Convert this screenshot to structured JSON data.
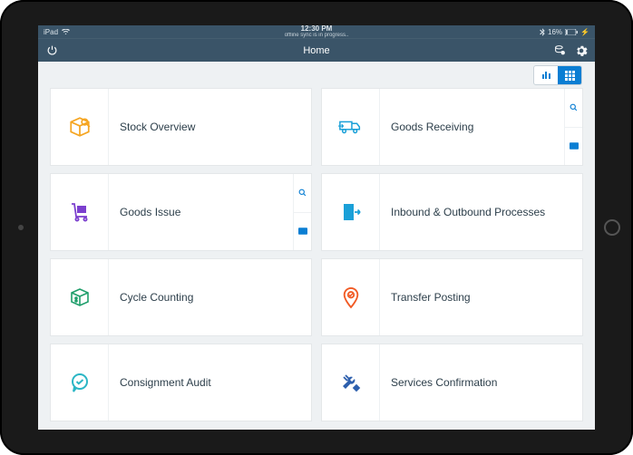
{
  "device": "iPad",
  "statusbar": {
    "time": "12:30 PM",
    "sync_text": "offline sync is in progress..",
    "bluetooth": true,
    "battery_text": "16%"
  },
  "navbar": {
    "title": "Home"
  },
  "view_toggle": {
    "chart_active": false,
    "grid_active": true
  },
  "tiles": [
    {
      "id": "stock-overview",
      "label": "Stock Overview",
      "icon": "box-search",
      "color": "#f5a623",
      "actions": []
    },
    {
      "id": "goods-receiving",
      "label": "Goods Receiving",
      "icon": "truck-arrow",
      "color": "#1aa0d8",
      "actions": [
        "search",
        "scan"
      ]
    },
    {
      "id": "goods-issue",
      "label": "Goods Issue",
      "icon": "trolley",
      "color": "#7b3fce",
      "actions": [
        "search",
        "scan"
      ]
    },
    {
      "id": "inbound-outbound",
      "label": "Inbound & Outbound Processes",
      "icon": "door-arrow",
      "color": "#1aa0d8",
      "actions": []
    },
    {
      "id": "cycle-counting",
      "label": "Cycle Counting",
      "icon": "box-count",
      "color": "#1f9e6b",
      "actions": []
    },
    {
      "id": "transfer-posting",
      "label": "Transfer Posting",
      "icon": "pin",
      "color": "#f15a24",
      "actions": []
    },
    {
      "id": "consignment-audit",
      "label": "Consignment Audit",
      "icon": "chat-check",
      "color": "#2bb6c5",
      "actions": []
    },
    {
      "id": "services-confirmation",
      "label": "Services Confirmation",
      "icon": "tools",
      "color": "#2d5fad",
      "actions": []
    }
  ]
}
